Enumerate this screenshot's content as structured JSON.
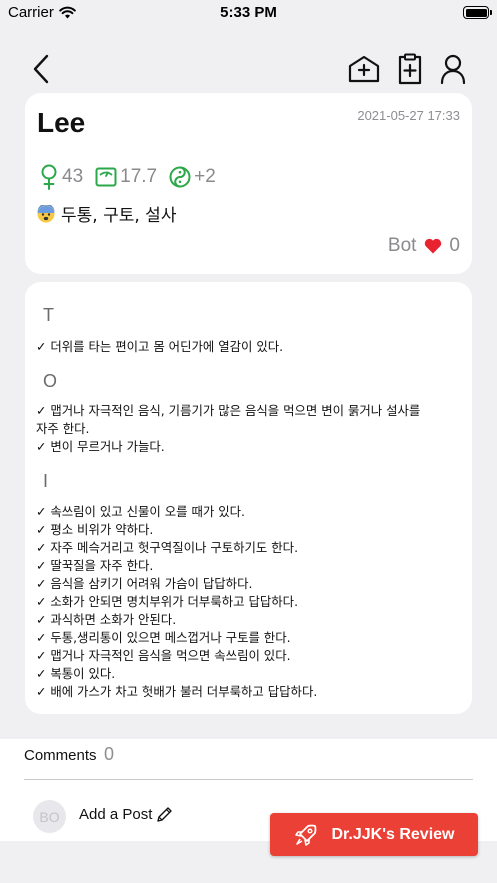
{
  "status_bar": {
    "carrier": "Carrier",
    "time": "5:33 PM",
    "battery_level": 1.0
  },
  "nav": {
    "back_icon": "chevron-left-icon",
    "actions": [
      "hospital-icon",
      "clipboard-plus-icon",
      "user-icon"
    ]
  },
  "patient": {
    "name": "Lee",
    "date": "2021-05-27 17:33",
    "age": "43",
    "bmi": "17.7",
    "constitution": "+2",
    "symptom_emoji": "anxious-face-emoji",
    "symptoms": "두통, 구토, 설사",
    "bot_label": "Bot",
    "likes": "0",
    "accent_color": "#2aa84a"
  },
  "notes": {
    "sections": [
      {
        "heading": "T",
        "items": [
          "✓ 더위를 타는 편이고 몸 어딘가에 열감이 있다."
        ]
      },
      {
        "heading": "O",
        "items": [
          "✓ 맵거나 자극적인 음식, 기름기가 많은 음식을 먹으면 변이 묽거나 설사를",
          "자주 한다.",
          "✓ 변이 무르거나 가늘다."
        ]
      },
      {
        "heading": "I",
        "items": [
          "✓ 속쓰림이 있고 신물이 오를 때가 있다.",
          "✓ 평소 비위가 약하다.",
          "✓ 자주 메슥거리고 헛구역질이나 구토하기도 한다.",
          "✓ 딸꾹질을 자주 한다.",
          "✓ 음식을 삼키기 어려워 가슴이 답답하다.",
          "✓ 소화가 안되면 명치부위가 더부룩하고 답답하다.",
          "✓ 과식하면 소화가 안된다.",
          "✓ 두통,생리통이 있으면 메스껍거나 구토를 한다.",
          "✓ 맵거나 자극적인 음식을 먹으면 속쓰림이 있다.",
          "✓ 복통이 있다.",
          "✓ 배에 가스가 차고 헛배가 불러 더부룩하고 답답하다."
        ]
      }
    ]
  },
  "comments": {
    "label": "Comments",
    "count": "0",
    "avatar_initials": "BO",
    "add_post_label": "Add a Post"
  },
  "review_button": {
    "label": "Dr.JJK's Review",
    "color": "#eb4035"
  }
}
